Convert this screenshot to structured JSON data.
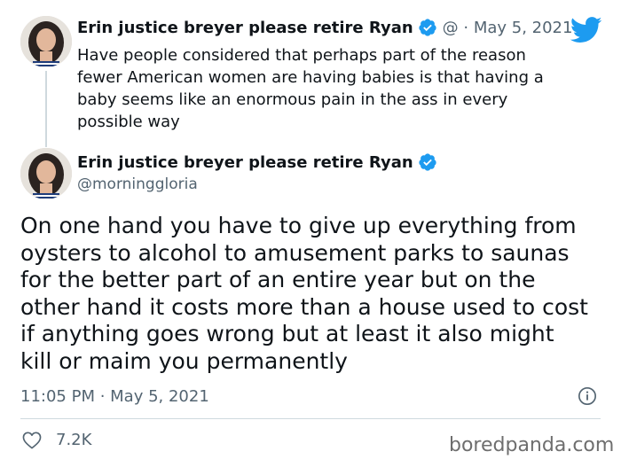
{
  "reply_tweet": {
    "display_name": "Erin justice breyer please retire Ryan",
    "handle_date": "@ · May 5, 2021",
    "text_lines": [
      "Have people considered that perhaps  part of the reason",
      "fewer American women are having babies is that having a",
      "baby seems like an enormous pain in the ass in every",
      "possible way"
    ]
  },
  "main_tweet": {
    "display_name": "Erin justice breyer please retire Ryan",
    "handle": "@morninggloria",
    "text_lines": [
      "On one hand you have to give up everything from",
      "oysters to alcohol to amusement parks to saunas",
      "for the better part of an entire year but on the",
      "other hand it costs more than a house used to cost",
      "if anything goes wrong but at least it also might",
      "kill or maim you permanently"
    ],
    "timestamp": "11:05 PM · May 5, 2021",
    "like_count": "7.2K"
  },
  "icons": {
    "verified": "verified-badge-icon",
    "brand": "twitter-bird-icon",
    "info": "info-icon",
    "like": "heart-icon"
  },
  "colors": {
    "verified_blue": "#1d9bf0",
    "secondary_text": "#536471",
    "divider": "#cfd9de"
  },
  "watermark": "boredpanda.com"
}
